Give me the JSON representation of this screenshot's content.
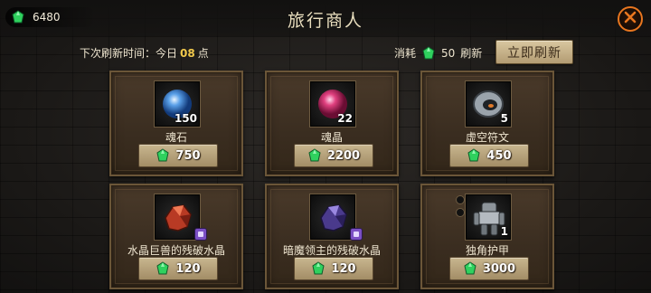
{
  "header": {
    "currency_amount": "6480",
    "title": "旅行商人"
  },
  "refresh": {
    "next_label": "下次刷新时间：今日",
    "next_hour": "08",
    "next_unit": "点",
    "cost_label": "消耗",
    "cost_amount": "50",
    "cost_suffix": "刷新",
    "button_label": "立即刷新"
  },
  "colors": {
    "gem": "#2fd15e",
    "accent_orange": "#e8761f",
    "hour_highlight": "#f2c94c"
  },
  "items": [
    {
      "name": "魂石",
      "quantity": "150",
      "price": "750",
      "icon": "blue-orb-icon"
    },
    {
      "name": "魂晶",
      "quantity": "22",
      "price": "2200",
      "icon": "pink-orb-icon"
    },
    {
      "name": "虚空符文",
      "quantity": "5",
      "price": "450",
      "icon": "void-rune-icon"
    },
    {
      "name": "水晶巨兽的残破水晶",
      "quantity": "",
      "price": "120",
      "icon": "red-crystal-icon"
    },
    {
      "name": "暗魔领主的残破水晶",
      "quantity": "",
      "price": "120",
      "icon": "purple-crystal-icon"
    },
    {
      "name": "独角护甲",
      "quantity": "1",
      "price": "3000",
      "icon": "armor-icon"
    }
  ]
}
